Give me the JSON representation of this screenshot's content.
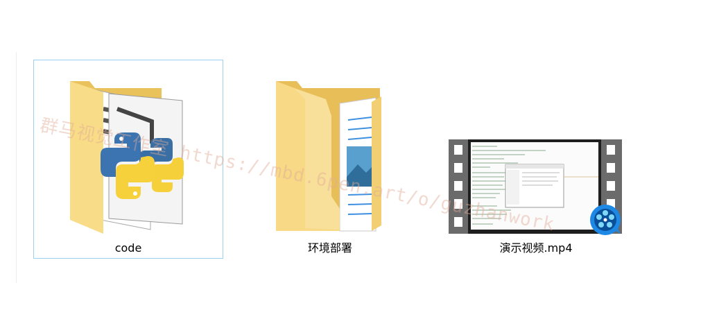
{
  "items": [
    {
      "name": "code",
      "type": "folder",
      "selected": true
    },
    {
      "name": "环境部署",
      "type": "folder",
      "selected": false
    },
    {
      "name": "演示视频.mp4",
      "type": "video",
      "selected": false
    }
  ],
  "watermark": "群马视觉工作室 https://mbd.6pen.art/o/guzhanwork",
  "icons": [
    "folder-python-icon",
    "folder-document-icon",
    "video-thumbnail-icon",
    "media-player-badge-icon"
  ],
  "colors": {
    "selection_border": "#99d1ef",
    "folder": "#f5d479",
    "player_badge": "#1e88e5"
  }
}
